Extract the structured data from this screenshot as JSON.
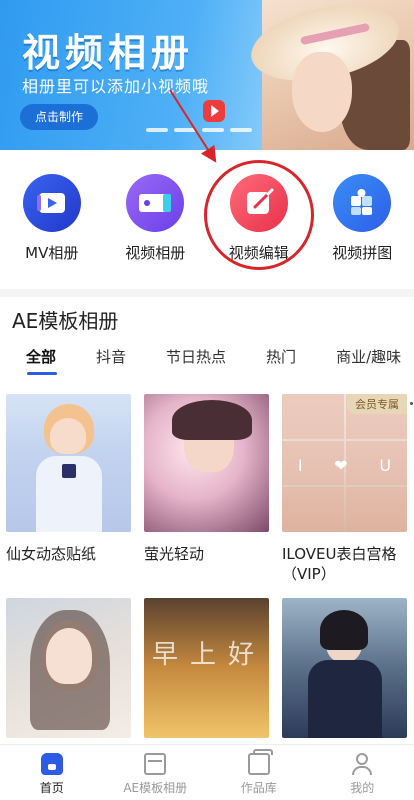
{
  "banner": {
    "title": "视频相册",
    "subtitle": "相册里可以添加小视频哦",
    "cta_label": "点击制作"
  },
  "quick_actions": [
    {
      "label": "MV相册",
      "icon": "play-card-icon"
    },
    {
      "label": "视频相册",
      "icon": "film-strip-icon"
    },
    {
      "label": "视频编辑",
      "icon": "edit-pen-icon"
    },
    {
      "label": "视频拼图",
      "icon": "puzzle-icon"
    }
  ],
  "section": {
    "title": "AE模板相册",
    "tabs": [
      "全部",
      "抖音",
      "节日热点",
      "热门",
      "商业/趣味"
    ],
    "active_tab": "全部"
  },
  "cards": [
    {
      "title": "仙女动态贴纸",
      "badge": ""
    },
    {
      "title": "萤光轻动",
      "badge": ""
    },
    {
      "title": "ILOVEU表白宫格（VIP）",
      "badge": "会员专属",
      "overlay_letters": [
        "I",
        "❤",
        "U"
      ]
    },
    {
      "title": "",
      "badge": ""
    },
    {
      "title": "",
      "badge": "",
      "overlay_text": "早上好"
    },
    {
      "title": "",
      "badge": ""
    }
  ],
  "bottom_nav": [
    {
      "label": "首页",
      "active": true
    },
    {
      "label": "AE模板相册",
      "active": false
    },
    {
      "label": "作品库",
      "active": false
    },
    {
      "label": "我的",
      "active": false
    }
  ],
  "colors": {
    "accent": "#2c5be6",
    "highlight_circle": "#d8252b",
    "banner_blue": "#2f9bf0"
  }
}
